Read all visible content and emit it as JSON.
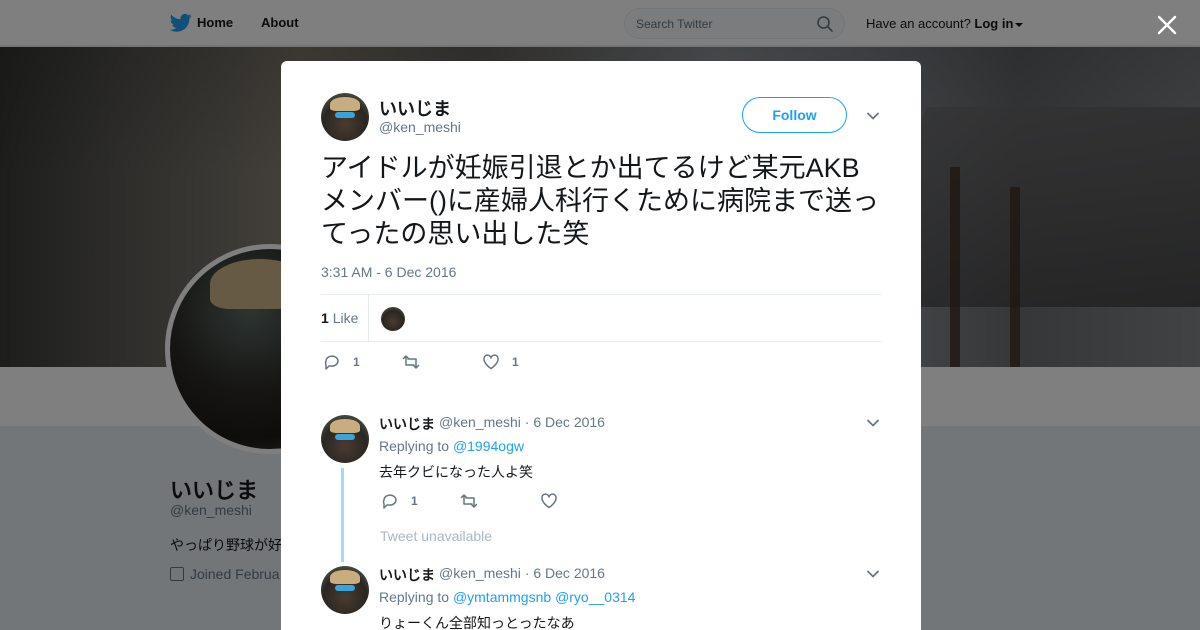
{
  "topbar": {
    "home_label": "Home",
    "about_label": "About",
    "search_placeholder": "Search Twitter",
    "have_account": "Have an account?",
    "login_label": "Log in"
  },
  "profile": {
    "name": "いいじま",
    "handle": "@ken_meshi",
    "bio": "やっぱり野球が好",
    "joined": "Joined Februa"
  },
  "tweet": {
    "author_name": "いいじま",
    "author_handle": "@ken_meshi",
    "follow_label": "Follow",
    "text": "アイドルが妊娠引退とか出てるけど某元AKBメンバー()に産婦人科行くために病院まで送ってったの思い出した笑",
    "timestamp": "3:31 AM - 6 Dec 2016",
    "like_count": "1",
    "like_label": "Like",
    "actions": {
      "reply_count": "1",
      "retweet_count": "",
      "like_count": "1"
    }
  },
  "replies": [
    {
      "name": "いいじま",
      "meta": "@ken_meshi · 6 Dec 2016",
      "replying_prefix": "Replying to",
      "replying_to": [
        "@1994ogw"
      ],
      "text": "去年クビになった人よ笑",
      "reply_count": "1",
      "retweet_count": "",
      "like_count": ""
    },
    {
      "name": "いいじま",
      "meta": "@ken_meshi · 6 Dec 2016",
      "replying_prefix": "Replying to",
      "replying_to": [
        "@ymtammgsnb",
        "@ryo__0314"
      ],
      "text": "りょーくん全部知っとったなあ"
    }
  ],
  "unavailable_text": "Tweet unavailable",
  "colors": {
    "accent": "#1da1f2",
    "thread_line": "#a4d9f9",
    "muted": "#657786"
  }
}
